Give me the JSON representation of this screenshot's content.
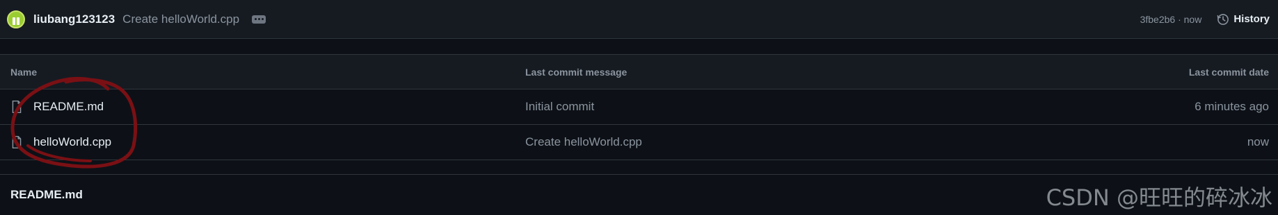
{
  "commit_bar": {
    "author": "liubang123123",
    "message": "Create helloWorld.cpp",
    "meta": "3fbe2b6 · now",
    "history_label": "History"
  },
  "table": {
    "headers": {
      "name": "Name",
      "message": "Last commit message",
      "date": "Last commit date"
    },
    "rows": [
      {
        "name": "README.md",
        "message": "Initial commit",
        "date": "6 minutes ago"
      },
      {
        "name": "helloWorld.cpp",
        "message": "Create helloWorld.cpp",
        "date": "now"
      }
    ]
  },
  "readme": {
    "title": "README.md"
  },
  "watermark": "CSDN @旺旺的碎冰冰",
  "colors": {
    "background": "#0d1117",
    "header_bg": "#161b22",
    "border": "#30363d",
    "muted_text": "#8b949e",
    "annotation_stroke": "#7a1014"
  }
}
